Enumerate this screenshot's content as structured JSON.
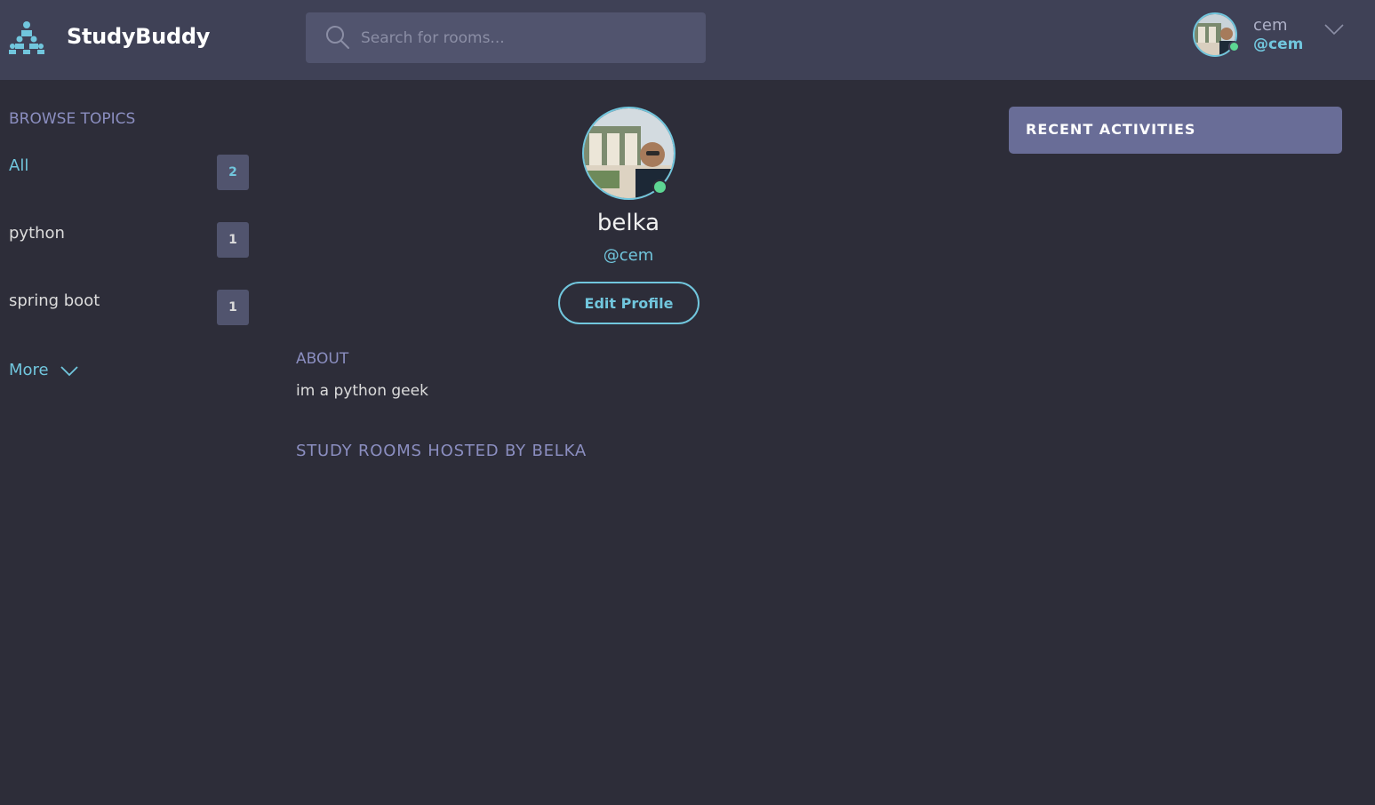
{
  "header": {
    "brand": "StudyBuddy",
    "search": {
      "placeholder": "Search for rooms...",
      "value": ""
    },
    "user": {
      "name": "cem",
      "handle": "@cem"
    }
  },
  "sidebar": {
    "title": "BROWSE TOPICS",
    "topics": [
      {
        "label": "All",
        "count": "2",
        "active": true
      },
      {
        "label": "python",
        "count": "1",
        "active": false
      },
      {
        "label": "spring boot",
        "count": "1",
        "active": false
      }
    ],
    "more_label": "More"
  },
  "profile": {
    "name": "belka",
    "handle": "@cem",
    "edit_label": "Edit Profile",
    "about_title": "ABOUT",
    "about_text": "im a python geek",
    "rooms_title": "STUDY ROOMS HOSTED BY BELKA"
  },
  "activity": {
    "title": "RECENT ACTIVITIES"
  },
  "colors": {
    "background": "#2d2d39",
    "header": "#3f4156",
    "accent": "#71c6dd",
    "muted": "#8b8ec0",
    "online": "#5dd693",
    "panel": "#696d97"
  }
}
